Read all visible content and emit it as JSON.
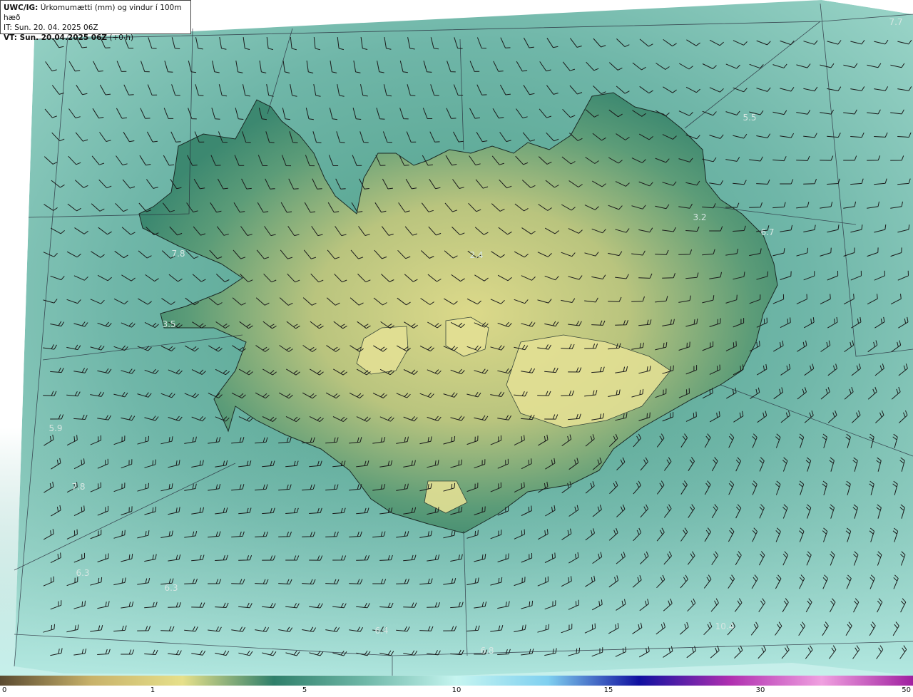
{
  "header": {
    "model": "UWC/IG:",
    "title": "Úrkomumætti (mm) og vindur í 100m hæð",
    "it_label": "IT:",
    "it_value": "Sun. 20. 04. 2025 06Z",
    "vt_label": "VT: Sun. 20.04.2025 06Z",
    "vt_offset": "(+0 h)"
  },
  "map_labels": [
    {
      "text": "7.7",
      "lon": 0
    },
    {
      "text": "5.5"
    },
    {
      "text": "3.2"
    },
    {
      "text": "6.7"
    },
    {
      "text": "7.8"
    },
    {
      "text": "2.4"
    },
    {
      "text": "3.5"
    },
    {
      "text": "5.9"
    },
    {
      "text": "7.8"
    },
    {
      "text": "6.3"
    },
    {
      "text": "6.3"
    },
    {
      "text": "6.4"
    },
    {
      "text": "6.8"
    },
    {
      "text": "10.4"
    }
  ],
  "legend": {
    "ticks": [
      "0",
      "1",
      "5",
      "10",
      "15",
      "30",
      "50"
    ],
    "colors": [
      "#5a4a30",
      "#c8b26a",
      "#e6e08a",
      "#2f7f6a",
      "#6fb8a8",
      "#c6f5f0",
      "#7fd0f0",
      "#1010a0",
      "#b030b0",
      "#f0a0e0",
      "#a020a0"
    ]
  },
  "colors": {
    "sea": "#6fb6a8",
    "land_low": "#3f8f76",
    "land_high": "#d6d88a"
  }
}
